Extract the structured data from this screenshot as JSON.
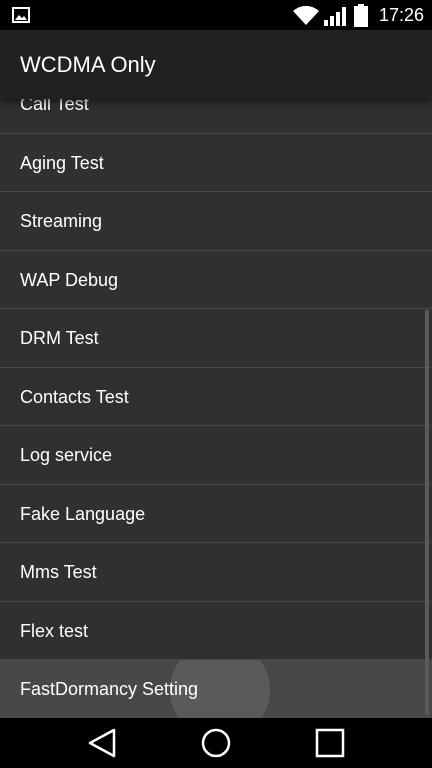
{
  "status_bar": {
    "time": "17:26",
    "icons": [
      "image-icon",
      "wifi-icon",
      "signal-icon",
      "battery-icon"
    ]
  },
  "app_bar": {
    "title": "WCDMA Only"
  },
  "list": {
    "items": [
      {
        "label": "Call Test"
      },
      {
        "label": "Aging Test"
      },
      {
        "label": "Streaming"
      },
      {
        "label": "WAP Debug"
      },
      {
        "label": "DRM Test"
      },
      {
        "label": "Contacts Test"
      },
      {
        "label": "Log service"
      },
      {
        "label": "Fake Language"
      },
      {
        "label": "Mms Test"
      },
      {
        "label": "Flex test"
      },
      {
        "label": "FastDormancy Setting",
        "pressed": true
      }
    ]
  },
  "nav_bar": {
    "buttons": [
      "back-icon",
      "home-icon",
      "recents-icon"
    ]
  },
  "colors": {
    "background": "#303030",
    "app_bar": "#212121",
    "divider": "#474747",
    "pressed_row": "#484848",
    "text": "#ffffff"
  }
}
